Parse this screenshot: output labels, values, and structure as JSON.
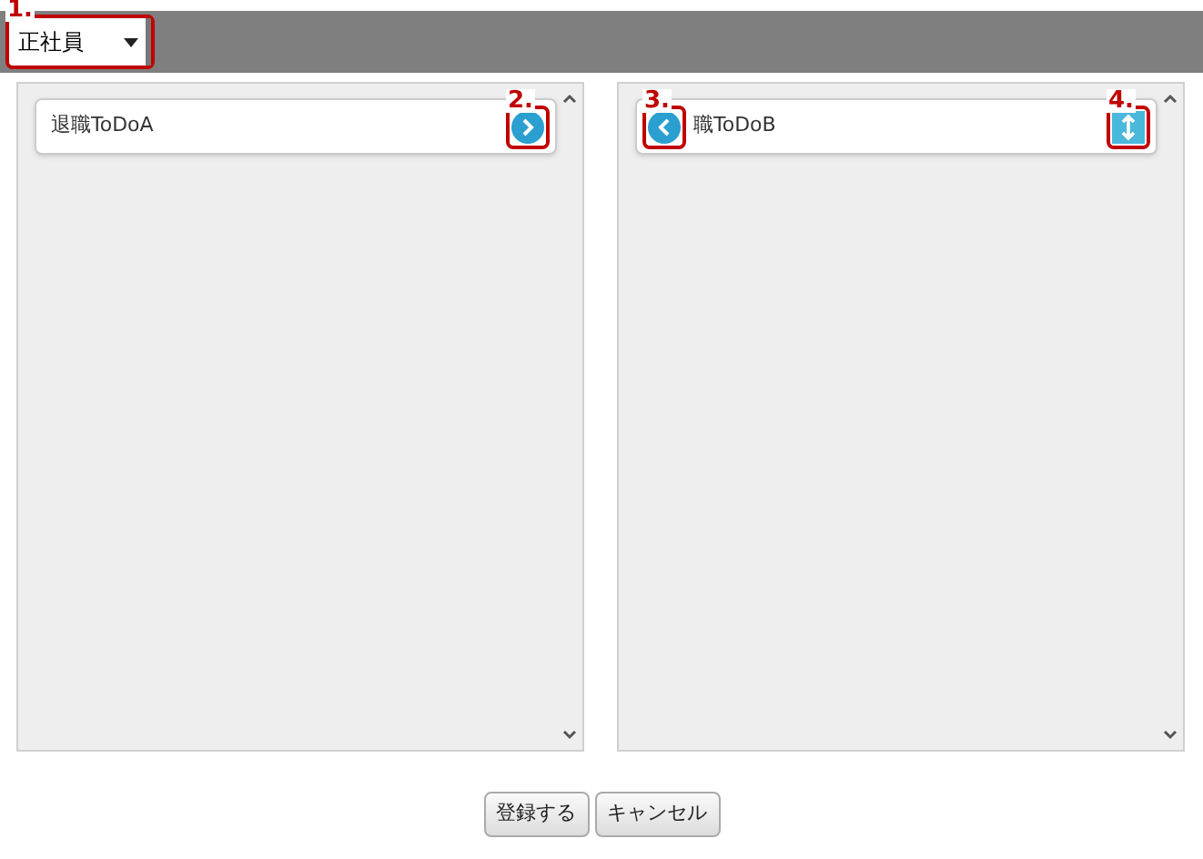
{
  "toolbar": {
    "select": {
      "value": "正社員",
      "callout": "1."
    }
  },
  "panels": [
    {
      "items": [
        {
          "text": "退職ToDoA",
          "kind": "move-right",
          "callout": "2."
        }
      ]
    },
    {
      "items": [
        {
          "text": "職ToDoB",
          "kind": "move-left",
          "callout": "3.",
          "handle_callout": "4."
        }
      ]
    }
  ],
  "buttons": [
    "登録する",
    "キャンセル"
  ]
}
